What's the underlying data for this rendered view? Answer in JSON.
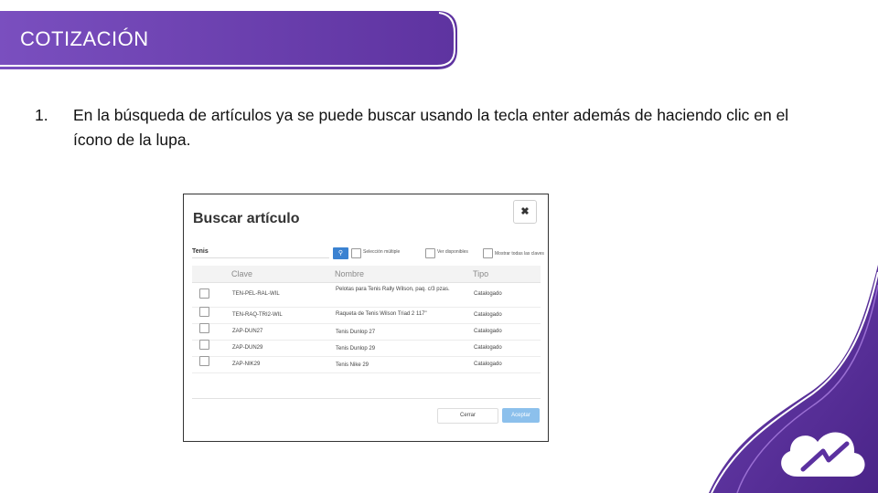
{
  "banner": {
    "title": "COTIZACIÓN"
  },
  "point": {
    "number": "1.",
    "text": "En la búsqueda de artículos ya se puede buscar usando la tecla enter además de haciendo clic en el ícono de la lupa."
  },
  "dialog": {
    "title": "Buscar artículo",
    "close_icon": "close-icon",
    "search_value": "Tenis",
    "search_icon": "search-icon",
    "options": {
      "multi": "Selección múltiple",
      "available": "Ver disponibles",
      "all_keys": "Mostrar todas las claves"
    },
    "columns": {
      "clave": "Clave",
      "nombre": "Nombre",
      "tipo": "Tipo"
    },
    "rows": [
      {
        "clave": "TEN-PEL-RAL-WIL",
        "nombre": "Pelotas para Tenis Rally Wilson, paq. c/3 pzas.",
        "tipo": "Catalogado"
      },
      {
        "clave": "TEN-RAQ-TRI2-WIL",
        "nombre": "Raqueta de Tenis Wilson Triad 2 117\"",
        "tipo": "Catalogado"
      },
      {
        "clave": "ZAP-DUN27",
        "nombre": "Tenis Dunlop 27",
        "tipo": "Catalogado"
      },
      {
        "clave": "ZAP-DUN29",
        "nombre": "Tenis Dunlop 29",
        "tipo": "Catalogado"
      },
      {
        "clave": "ZAP-NIK29",
        "nombre": "Tenis Nike 29",
        "tipo": "Catalogado"
      }
    ],
    "buttons": {
      "close": "Cerrar",
      "accept": "Aceptar"
    }
  },
  "colors": {
    "brand_purple": "#6b3fa8",
    "accent_light_purple": "#9a6fd3",
    "primary_blue": "#3b82d1"
  },
  "logo_icon": "cloud-lightning-icon"
}
